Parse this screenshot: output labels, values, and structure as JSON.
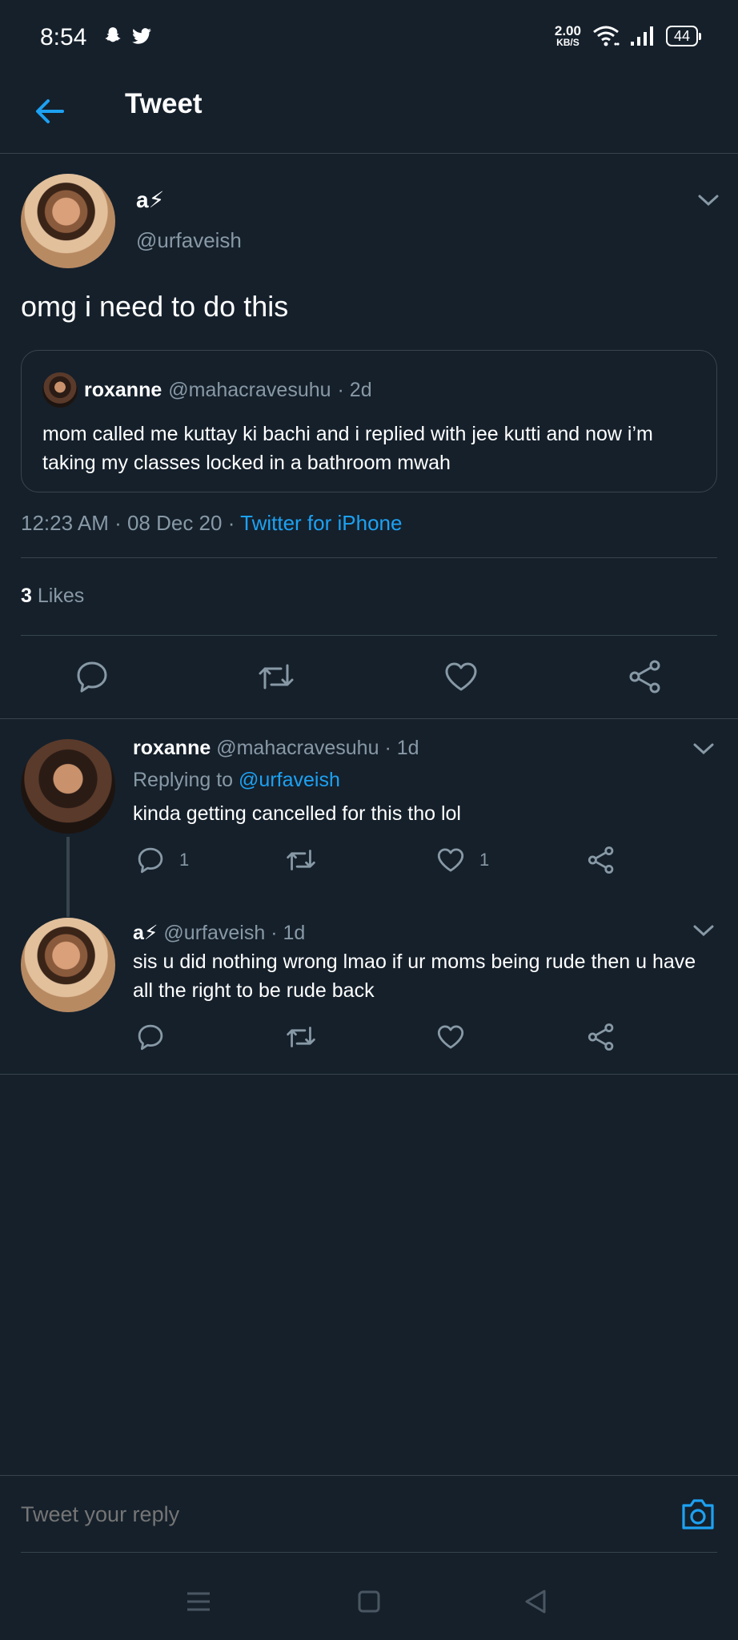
{
  "status_bar": {
    "time": "8:54",
    "net_speed_value": "2.00",
    "net_speed_unit": "KB/S",
    "battery": "44"
  },
  "header": {
    "title": "Tweet"
  },
  "main_tweet": {
    "name": "a⚡",
    "handle": "@urfaveish",
    "text": "omg i need to do this",
    "quote": {
      "name": "roxanne",
      "handle": "@mahacravesuhu",
      "time": "· 2d",
      "text": "mom called me kuttay ki bachi and i replied with jee kutti and now i’m taking my classes locked in a bathroom mwah"
    },
    "timestamp": "12:23 AM · 08 Dec 20 ·",
    "source": "Twitter for iPhone",
    "likes_count": "3",
    "likes_label": "Likes"
  },
  "replies": [
    {
      "name": "roxanne",
      "handle": "@mahacravesuhu",
      "time": "· 1d",
      "replying_label": "Replying to",
      "replying_to": "@urfaveish",
      "text": "kinda getting cancelled for this tho lol",
      "reply_count": "1",
      "like_count": "1"
    },
    {
      "name": "a⚡",
      "handle": "@urfaveish",
      "time": "· 1d",
      "text": "sis u did nothing wrong lmao if ur moms being rude then u have all the right to be rude back"
    }
  ],
  "reply_bar": {
    "placeholder": "Tweet your reply"
  },
  "colors": {
    "background": "#15202b",
    "accent": "#1da1f2",
    "muted": "#8899a6",
    "border": "#38444d"
  }
}
